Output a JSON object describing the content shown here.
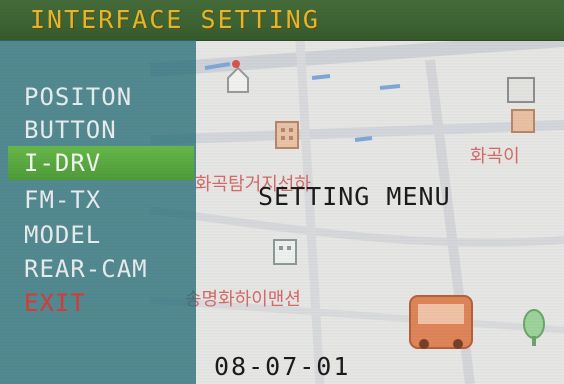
{
  "header": {
    "title": "INTERFACE SETTING"
  },
  "menu": {
    "selected_index": 2,
    "items": [
      {
        "label": "POSITON"
      },
      {
        "label": "BUTTON"
      },
      {
        "label": "I-DRV"
      },
      {
        "label": "FM-TX"
      },
      {
        "label": "MODEL"
      },
      {
        "label": "REAR-CAM"
      },
      {
        "label": "EXIT"
      }
    ]
  },
  "content": {
    "heading": "SETTING MENU",
    "version": "08-07-01"
  },
  "map": {
    "labels": [
      "화곡탐거지선하",
      "송명화하이맨션",
      "화곡이"
    ]
  },
  "colors": {
    "title_bar": "#3d6333",
    "title_text": "#e4b82c",
    "menu_panel": "#286e78",
    "selected_item": "#5aaa42",
    "exit_text": "#d83b34",
    "map_background": "#e7e8e6"
  }
}
